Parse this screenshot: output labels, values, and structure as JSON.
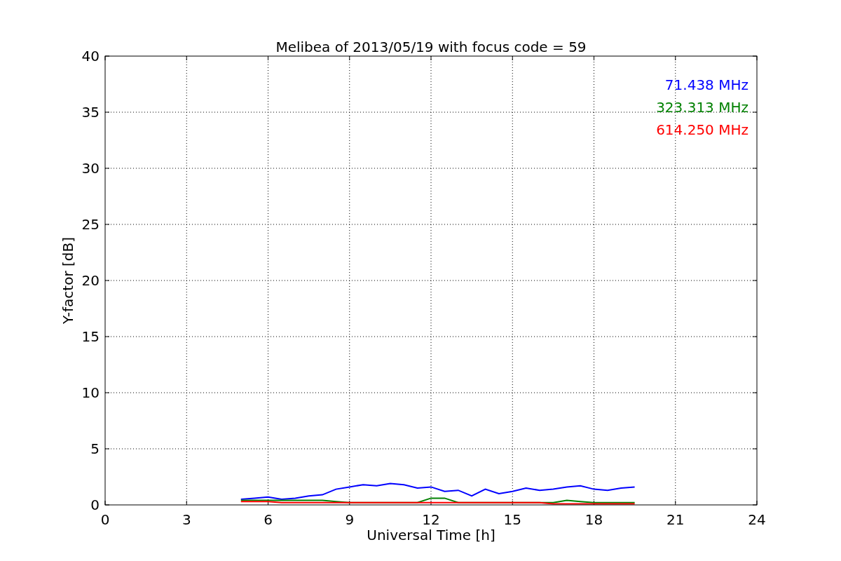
{
  "chart": {
    "chart_data": {
      "type": "line",
      "title": "Melibea of 2013/05/19 with focus code = 59",
      "xlabel": "Universal Time [h]",
      "ylabel": "Y-factor [dB]",
      "x": [
        5,
        5.5,
        6,
        6.5,
        7,
        7.5,
        8,
        8.5,
        9,
        9.5,
        10,
        10.5,
        11,
        11.5,
        12,
        12.5,
        13,
        13.5,
        14,
        14.5,
        15,
        15.5,
        16,
        16.5,
        17,
        17.5,
        18,
        18.5,
        19,
        19.5
      ],
      "series": [
        {
          "name": "71.438 MHz",
          "color": "#0000ff",
          "values": [
            0.5,
            0.6,
            0.7,
            0.5,
            0.6,
            0.8,
            0.9,
            1.4,
            1.6,
            1.8,
            1.7,
            1.9,
            1.8,
            1.5,
            1.6,
            1.2,
            1.3,
            0.8,
            1.4,
            1.0,
            1.2,
            1.5,
            1.3,
            1.4,
            1.6,
            1.7,
            1.4,
            1.3,
            1.5,
            1.6
          ]
        },
        {
          "name": "323.313 MHz",
          "color": "#008000",
          "values": [
            0.4,
            0.4,
            0.4,
            0.4,
            0.4,
            0.4,
            0.4,
            0.3,
            0.2,
            0.2,
            0.2,
            0.2,
            0.2,
            0.2,
            0.6,
            0.6,
            0.2,
            0.2,
            0.2,
            0.2,
            0.2,
            0.2,
            0.2,
            0.2,
            0.4,
            0.3,
            0.2,
            0.2,
            0.2,
            0.2
          ]
        },
        {
          "name": "614.250 MHz",
          "color": "#ff0000",
          "values": [
            0.3,
            0.3,
            0.3,
            0.2,
            0.2,
            0.2,
            0.2,
            0.2,
            0.2,
            0.2,
            0.2,
            0.2,
            0.2,
            0.2,
            0.2,
            0.2,
            0.2,
            0.2,
            0.2,
            0.2,
            0.2,
            0.2,
            0.2,
            0.1,
            0.1,
            0.1,
            0.1,
            0.1,
            0.1,
            0.1
          ]
        }
      ],
      "grid": true,
      "xlim": [
        0,
        24
      ],
      "ylim": [
        0,
        40
      ],
      "xticks": [
        0,
        3,
        6,
        9,
        12,
        15,
        18,
        21,
        24
      ],
      "yticks": [
        0,
        5,
        10,
        15,
        20,
        25,
        30,
        35,
        40
      ]
    }
  }
}
